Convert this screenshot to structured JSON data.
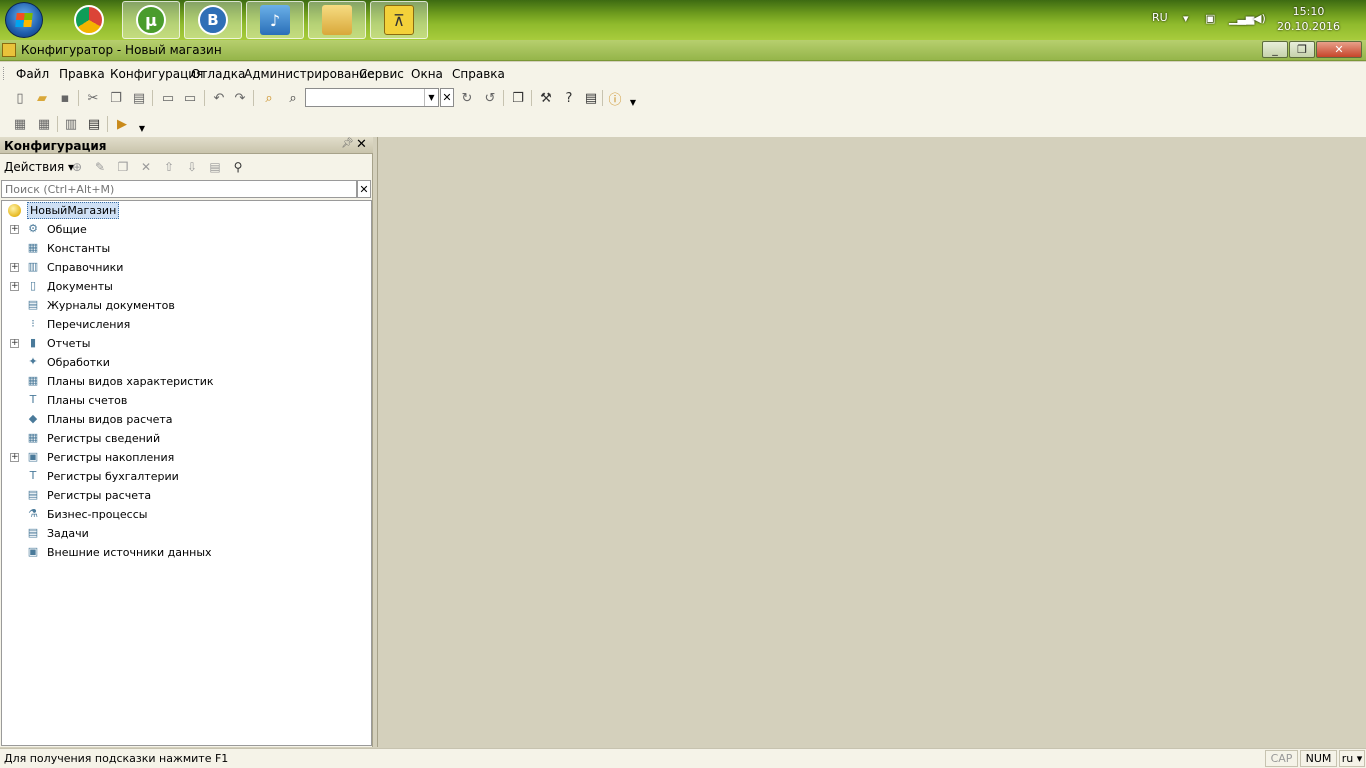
{
  "taskbar": {
    "apps": [
      "Google Chrome",
      "uTorrent",
      "VK",
      "Music",
      "Explorer",
      "1C"
    ],
    "lang": "RU",
    "time": "15:10",
    "date": "20.10.2016"
  },
  "window": {
    "title": "Конфигуратор - Новый магазин",
    "min": "_",
    "max": "❐",
    "close": "✕"
  },
  "menu": [
    "Файл",
    "Правка",
    "Конфигурация",
    "Отладка",
    "Администрирование",
    "Сервис",
    "Окна",
    "Справка"
  ],
  "panel": {
    "title": "Конфигурация",
    "actions_label": "Действия ▾",
    "search_placeholder": "Поиск (Ctrl+Alt+M)",
    "root": "НовыйМагазин",
    "items": [
      {
        "label": "Общие",
        "icon": "common-icon",
        "expandable": true
      },
      {
        "label": "Константы",
        "icon": "constants-icon",
        "expandable": false
      },
      {
        "label": "Справочники",
        "icon": "catalogs-icon",
        "expandable": true
      },
      {
        "label": "Документы",
        "icon": "documents-icon",
        "expandable": true
      },
      {
        "label": "Журналы документов",
        "icon": "journals-icon",
        "expandable": false
      },
      {
        "label": "Перечисления",
        "icon": "enums-icon",
        "expandable": false
      },
      {
        "label": "Отчеты",
        "icon": "reports-icon",
        "expandable": true
      },
      {
        "label": "Обработки",
        "icon": "processing-icon",
        "expandable": false
      },
      {
        "label": "Планы видов характеристик",
        "icon": "chart-of-characteristics-icon",
        "expandable": false
      },
      {
        "label": "Планы счетов",
        "icon": "chart-of-accounts-icon",
        "expandable": false
      },
      {
        "label": "Планы видов расчета",
        "icon": "chart-of-calculations-icon",
        "expandable": false
      },
      {
        "label": "Регистры сведений",
        "icon": "info-registers-icon",
        "expandable": false
      },
      {
        "label": "Регистры накопления",
        "icon": "accumulation-registers-icon",
        "expandable": true
      },
      {
        "label": "Регистры бухгалтерии",
        "icon": "accounting-registers-icon",
        "expandable": false
      },
      {
        "label": "Регистры расчета",
        "icon": "calculation-registers-icon",
        "expandable": false
      },
      {
        "label": "Бизнес-процессы",
        "icon": "business-processes-icon",
        "expandable": false
      },
      {
        "label": "Задачи",
        "icon": "tasks-icon",
        "expandable": false
      },
      {
        "label": "Внешние источники данных",
        "icon": "external-data-sources-icon",
        "expandable": false
      }
    ]
  },
  "status": {
    "hint": "Для получения подсказки нажмите F1",
    "cap": "CAP",
    "num": "NUM",
    "lang": "ru ▾"
  }
}
